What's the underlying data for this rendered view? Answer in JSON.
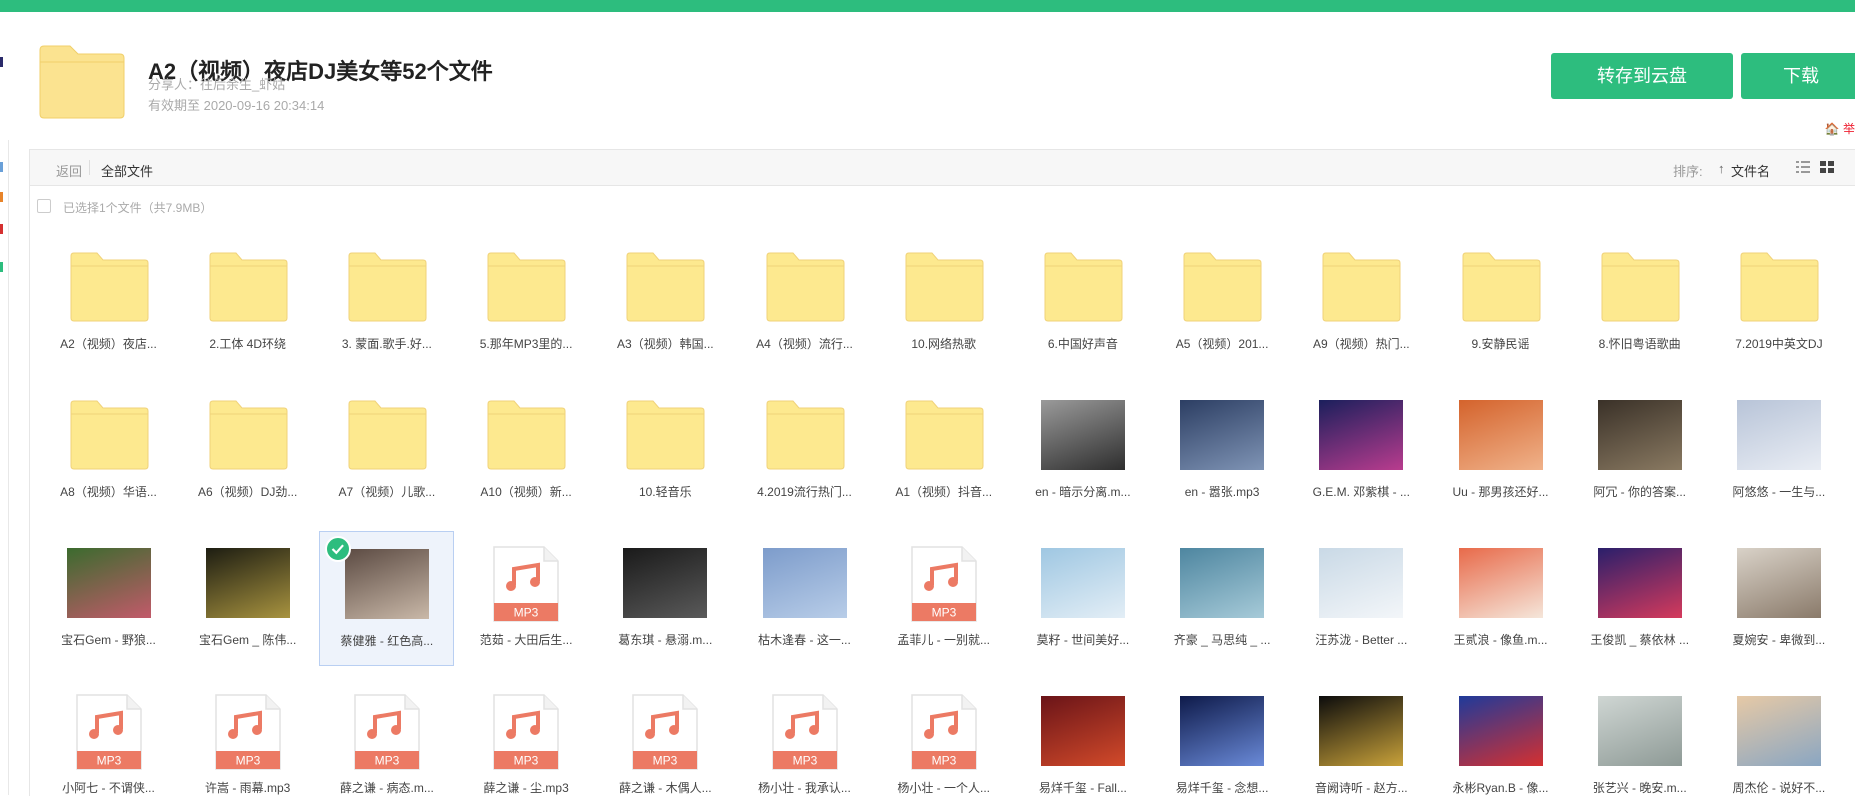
{
  "share": {
    "title": "A2（视频）夜店DJ美女等52个文件",
    "sharer": "分享人：往后余生_虾姑",
    "expiry": "有效期至 2020-09-16 20:34:14",
    "save_button": "转存到云盘",
    "download_button": "下载",
    "report": "🏠 举"
  },
  "toolbar": {
    "back": "返回",
    "breadcrumb": "全部文件",
    "sort_label": "排序:",
    "sort_arrow": "↑",
    "sort_field": "文件名",
    "list_view_icon": "list-view-icon",
    "grid_view_icon": "grid-view-icon"
  },
  "selection": {
    "text": "已选择1个文件（共7.9MB）"
  },
  "colors": {
    "accent": "#2dbd7e",
    "folder": "#fde98f",
    "mp3": "#ec7a64"
  },
  "files": [
    {
      "name": "A2（视频）夜店...",
      "kind": "folder"
    },
    {
      "name": "2.工体 4D环绕",
      "kind": "folder"
    },
    {
      "name": "3. 蒙面.歌手.好...",
      "kind": "folder"
    },
    {
      "name": "5.那年MP3里的...",
      "kind": "folder"
    },
    {
      "name": "A3（视频）韩国...",
      "kind": "folder"
    },
    {
      "name": "A4（视频）流行...",
      "kind": "folder"
    },
    {
      "name": "10.网络热歌",
      "kind": "folder"
    },
    {
      "name": "6.中国好声音",
      "kind": "folder"
    },
    {
      "name": "A5（视频）201...",
      "kind": "folder"
    },
    {
      "name": "A9（视频）热门...",
      "kind": "folder"
    },
    {
      "name": "9.安静民谣",
      "kind": "folder"
    },
    {
      "name": "8.怀旧粤语歌曲",
      "kind": "folder"
    },
    {
      "name": "7.2019中英文DJ",
      "kind": "folder"
    },
    {
      "name": "A8（视频）华语...",
      "kind": "folder"
    },
    {
      "name": "A6（视频）DJ劲...",
      "kind": "folder"
    },
    {
      "name": "A7（视频）儿歌...",
      "kind": "folder"
    },
    {
      "name": "A10（视频）新...",
      "kind": "folder"
    },
    {
      "name": "10.轻音乐",
      "kind": "folder"
    },
    {
      "name": "4.2019流行热门...",
      "kind": "folder"
    },
    {
      "name": "A1（视频）抖音...",
      "kind": "folder"
    },
    {
      "name": "en - 暗示分离.m...",
      "kind": "image",
      "colors": [
        "#9a9a9a",
        "#2e2e2e"
      ]
    },
    {
      "name": "en - 嚣张.mp3",
      "kind": "image",
      "colors": [
        "#2c3e63",
        "#7f94b5"
      ]
    },
    {
      "name": "G.E.M. 邓紫棋 - ...",
      "kind": "image",
      "colors": [
        "#1b1f5c",
        "#b93c8e"
      ]
    },
    {
      "name": "Uu - 那男孩还好...",
      "kind": "image",
      "colors": [
        "#d4632c",
        "#f0b28a"
      ]
    },
    {
      "name": "阿冗 - 你的答案...",
      "kind": "image",
      "colors": [
        "#3a3128",
        "#8a7a62"
      ]
    },
    {
      "name": "阿悠悠 - 一生与...",
      "kind": "image",
      "colors": [
        "#b8c4d8",
        "#e9edf4"
      ]
    },
    {
      "name": "宝石Gem - 野狼...",
      "kind": "image",
      "colors": [
        "#3b6b2e",
        "#c25a6a"
      ]
    },
    {
      "name": "宝石Gem _ 陈伟...",
      "kind": "image",
      "colors": [
        "#1d1d12",
        "#a8933f"
      ]
    },
    {
      "name": "蔡健雅 - 红色高...",
      "kind": "image",
      "colors": [
        "#5c4b43",
        "#c9b8a8"
      ],
      "selected": true
    },
    {
      "name": "范茹 - 大田后生...",
      "kind": "mp3",
      "label": "MP3"
    },
    {
      "name": "葛东琪 - 悬溺.m...",
      "kind": "image",
      "colors": [
        "#1a1a1a",
        "#5a5a5a"
      ]
    },
    {
      "name": "枯木逢春 - 这一...",
      "kind": "image",
      "colors": [
        "#7d9ccb",
        "#b8cde8"
      ]
    },
    {
      "name": "孟菲儿 - 一别就...",
      "kind": "mp3",
      "label": "MP3"
    },
    {
      "name": "莫籽 - 世间美好...",
      "kind": "image",
      "colors": [
        "#9fc7e2",
        "#e3eef6"
      ]
    },
    {
      "name": "齐豪 _ 马思纯 _ ...",
      "kind": "image",
      "colors": [
        "#4e86a0",
        "#a6cad8"
      ]
    },
    {
      "name": "汪苏泷 - Better ...",
      "kind": "image",
      "colors": [
        "#c9d9e6",
        "#f3f6f9"
      ]
    },
    {
      "name": "王贰浪 - 像鱼.m...",
      "kind": "image",
      "colors": [
        "#e86a4a",
        "#f5e6da"
      ]
    },
    {
      "name": "王俊凯 _ 蔡依林 ...",
      "kind": "image",
      "colors": [
        "#2a1f6b",
        "#d53a5c"
      ]
    },
    {
      "name": "夏婉安 - 卑微到...",
      "kind": "image",
      "colors": [
        "#d9d2c8",
        "#8a7a6a"
      ]
    },
    {
      "name": "小阿七 - 不谓侠...",
      "kind": "mp3",
      "label": "MP3"
    },
    {
      "name": "许嵩 - 雨幕.mp3",
      "kind": "mp3",
      "label": "MP3"
    },
    {
      "name": "薛之谦 - 病态.m...",
      "kind": "mp3",
      "label": "MP3"
    },
    {
      "name": "薛之谦 - 尘.mp3",
      "kind": "mp3",
      "label": "MP3"
    },
    {
      "name": "薛之谦 - 木偶人...",
      "kind": "mp3",
      "label": "MP3"
    },
    {
      "name": "杨小壮 - 我承认...",
      "kind": "mp3",
      "label": "MP3"
    },
    {
      "name": "杨小壮 - 一个人...",
      "kind": "mp3",
      "label": "MP3"
    },
    {
      "name": "易烊千玺 - Fall...",
      "kind": "image",
      "colors": [
        "#6a1418",
        "#d24a2a"
      ]
    },
    {
      "name": "易烊千玺 - 念想...",
      "kind": "image",
      "colors": [
        "#0e1a4a",
        "#6a8ad8"
      ]
    },
    {
      "name": "音阙诗听 - 赵方...",
      "kind": "image",
      "colors": [
        "#0c0c0c",
        "#c9a23a"
      ]
    },
    {
      "name": "永彬Ryan.B - 像...",
      "kind": "image",
      "colors": [
        "#1f3a9a",
        "#d53030"
      ]
    },
    {
      "name": "张艺兴 - 晚安.m...",
      "kind": "image",
      "colors": [
        "#cfd6d3",
        "#8e9a96"
      ]
    },
    {
      "name": "周杰伦 - 说好不...",
      "kind": "image",
      "colors": [
        "#e6c9a6",
        "#8aa6c2"
      ]
    }
  ]
}
